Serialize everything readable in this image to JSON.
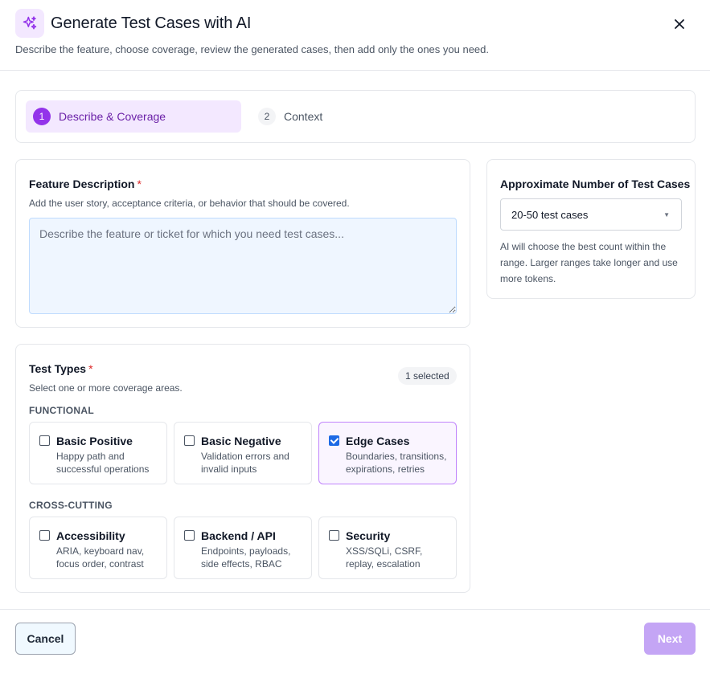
{
  "header": {
    "title": "Generate Test Cases with AI",
    "subtitle": "Describe the feature, choose coverage, review the generated cases, then add only the ones you need.",
    "icon": "sparkles-icon",
    "close_icon": "close-icon",
    "accent_color": "#9333ea"
  },
  "stepper": {
    "steps": [
      {
        "number": "1",
        "label": "Describe & Coverage",
        "active": true
      },
      {
        "number": "2",
        "label": "Context",
        "active": false
      }
    ]
  },
  "feature": {
    "label": "Feature Description",
    "required_mark": "*",
    "help": "Add the user story, acceptance criteria, or behavior that should be covered.",
    "placeholder": "Describe the feature or ticket for which you need test cases...",
    "value": ""
  },
  "count": {
    "label": "Approximate Number of Test Cases",
    "selected": "20-50 test cases",
    "caret_icon": "chevron-down-icon",
    "help": "AI will choose the best count within the range. Larger ranges take longer and use more tokens."
  },
  "types": {
    "label": "Test Types",
    "required_mark": "*",
    "help": "Select one or more coverage areas.",
    "badge": "1 selected",
    "sections": [
      {
        "title": "FUNCTIONAL",
        "options": [
          {
            "title": "Basic Positive",
            "desc": "Happy path and successful operations",
            "checked": false
          },
          {
            "title": "Basic Negative",
            "desc": "Validation errors and invalid inputs",
            "checked": false
          },
          {
            "title": "Edge Cases",
            "desc": "Boundaries, transitions, expirations, retries",
            "checked": true
          }
        ]
      },
      {
        "title": "CROSS-CUTTING",
        "options": [
          {
            "title": "Accessibility",
            "desc": "ARIA, keyboard nav, focus order, contrast",
            "checked": false
          },
          {
            "title": "Backend / API",
            "desc": "Endpoints, payloads, side effects, RBAC",
            "checked": false
          },
          {
            "title": "Security",
            "desc": "XSS/SQLi, CSRF, replay, escalation",
            "checked": false
          }
        ]
      }
    ]
  },
  "footer": {
    "cancel_label": "Cancel",
    "next_label": "Next"
  }
}
